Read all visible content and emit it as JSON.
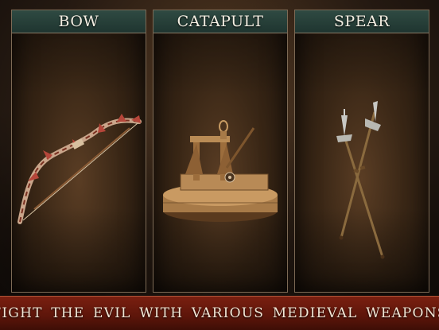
{
  "panels": [
    {
      "label": "BOW",
      "weapon": "bow-icon"
    },
    {
      "label": "CATAPULT",
      "weapon": "catapult-icon"
    },
    {
      "label": "SPEAR",
      "weapon": "crossed-spears-icon"
    }
  ],
  "banner": {
    "text": "FIGHT THE EVIL WITH VARIOUS MEDIEVAL WEAPONS"
  },
  "colors": {
    "header_teal": "#1f3530",
    "banner_red": "#5c150a",
    "text_cream": "#f4efe3"
  }
}
